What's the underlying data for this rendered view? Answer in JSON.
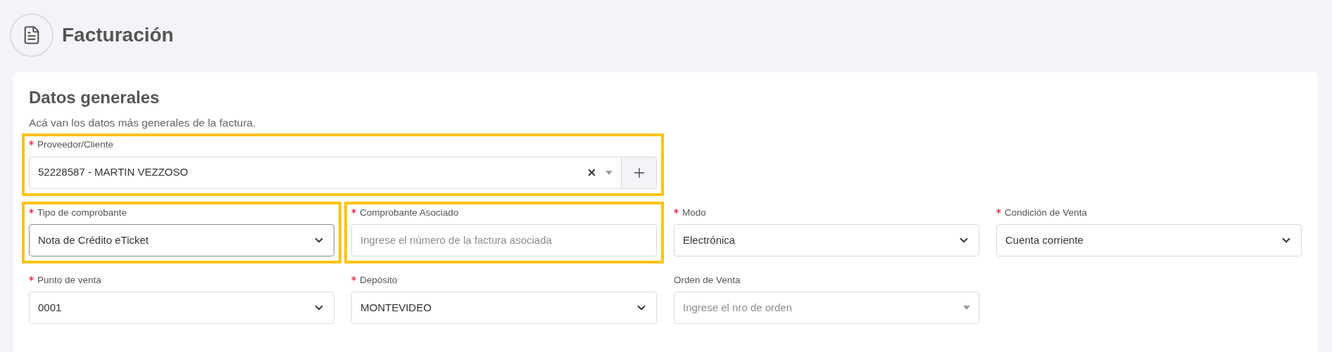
{
  "page": {
    "title": "Facturación"
  },
  "section": {
    "title": "Datos generales",
    "description": "Acá van los datos más generales de la factura."
  },
  "fields": [
    {
      "kind": "search-select",
      "label": "Proveedor/Cliente",
      "required": true,
      "highlighted": true,
      "focused": false,
      "value": "52228587 - MARTIN VEZZOSO"
    },
    {
      "kind": "select",
      "label": "Tipo de comprobante",
      "required": true,
      "highlighted": true,
      "focused": true,
      "value": "Nota de Crédito eTicket"
    },
    {
      "kind": "text",
      "label": "Comprobante Asociado",
      "required": true,
      "highlighted": true,
      "focused": false,
      "placeholder": "Ingrese el número de la factura asociada"
    },
    {
      "kind": "select",
      "label": "Modo",
      "required": true,
      "highlighted": false,
      "focused": false,
      "value": "Electrónica"
    },
    {
      "kind": "select",
      "label": "Condición de Venta",
      "required": true,
      "highlighted": false,
      "focused": false,
      "value": "Cuenta corriente"
    },
    {
      "kind": "select",
      "label": "Punto de venta",
      "required": true,
      "highlighted": false,
      "focused": false,
      "value": "0001"
    },
    {
      "kind": "select",
      "label": "Depósito",
      "required": true,
      "highlighted": false,
      "focused": false,
      "value": "MONTEVIDEO"
    },
    {
      "kind": "combo",
      "label": "Orden de Venta",
      "required": false,
      "highlighted": false,
      "focused": false,
      "placeholder": "Ingrese el nro de orden"
    }
  ]
}
